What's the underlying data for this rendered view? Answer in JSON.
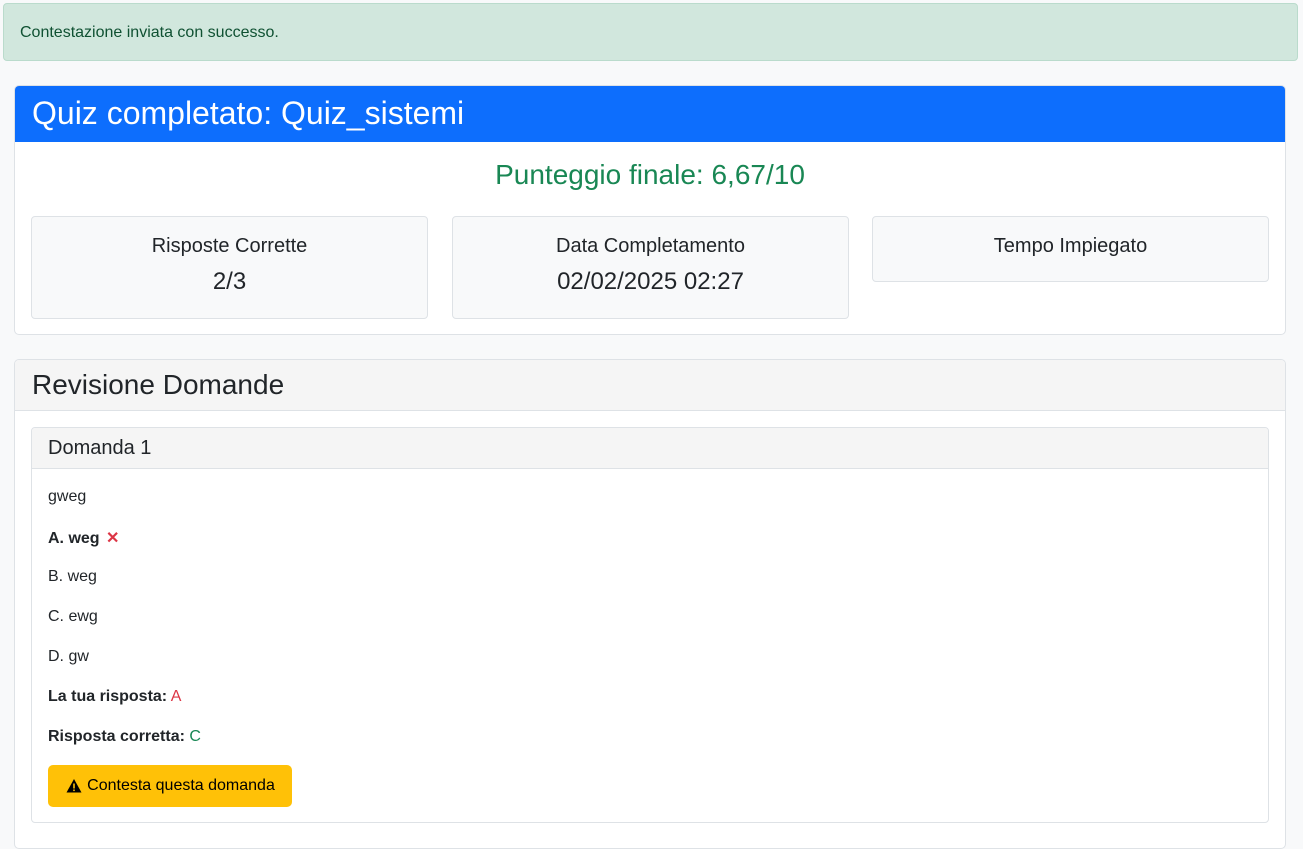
{
  "alert": {
    "message": "Contestazione inviata con successo."
  },
  "quiz": {
    "title": "Quiz completato: Quiz_sistemi",
    "score": "Punteggio finale: 6,67/10",
    "stats": [
      {
        "label": "Risposte Corrette",
        "value": "2/3"
      },
      {
        "label": "Data Completamento",
        "value": "02/02/2025 02:27"
      },
      {
        "label": "Tempo Impiegato",
        "value": ""
      }
    ]
  },
  "review": {
    "title": "Revisione Domande",
    "questions": [
      {
        "header": "Domanda 1",
        "text": "gweg",
        "options": [
          "A. weg",
          "B. weg",
          "C. ewg",
          "D. gw"
        ],
        "selected_icon": "x-icon",
        "your_answer_label": "La tua risposta:",
        "your_answer": "A",
        "correct_answer_label": "Risposta corretta:",
        "correct_answer": "C",
        "contest_button": "Contesta questa domanda",
        "contest_icon": "warning-triangle-icon"
      }
    ]
  },
  "colors": {
    "primary": "#0d6efd",
    "success": "#198754",
    "danger": "#dc3545",
    "warning": "#ffc107",
    "alert_bg": "#d1e7dd"
  }
}
